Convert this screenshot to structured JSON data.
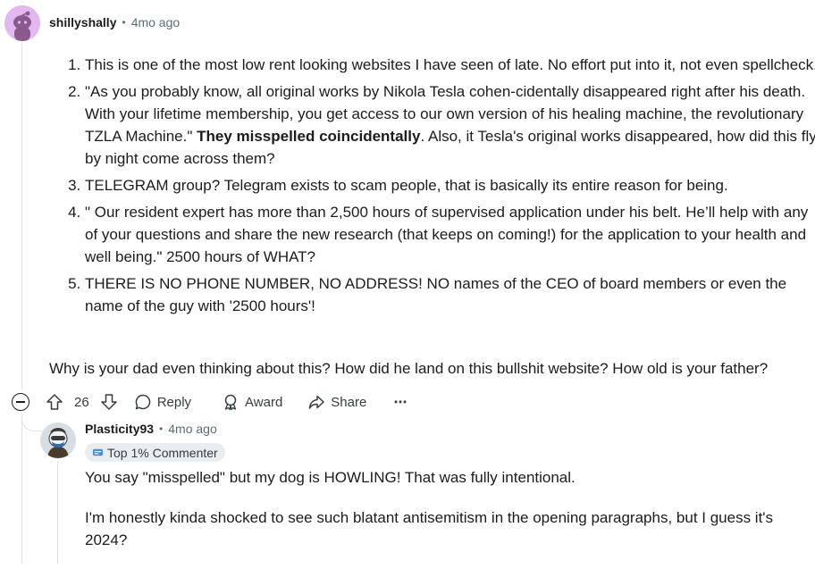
{
  "comment": {
    "author": "shillyshally",
    "time": "4mo ago",
    "list": [
      {
        "text": "This is one of the most low rent looking websites I have seen of late. No effort put into it, not even spellcheck."
      },
      {
        "before": "\"As you probably know, all original works by Nikola Tesla cohen-cidentally disappeared right after his death. With your lifetime membership, you get access to our own version of his healing machine, the revolutionary TZLA Machine.\" ",
        "bold": "They misspelled coincidentally",
        "after": ". Also, it Tesla's original works disappeared, how did this fly by night come across them?"
      },
      {
        "text": "TELEGRAM group? Telegram exists to scam people, that is basically its entire reason for being."
      },
      {
        "text": "\" Our resident expert has more than 2,500 hours of supervised application under his belt. He’ll help with any of your questions and share the new research (that keeps on coming!) for the application to your health and well being.\" 2500 hours of WHAT?"
      },
      {
        "text": "THERE IS NO PHONE NUMBER, NO ADDRESS! NO names of the CEO of board members or even the name of the guy with '2500 hours'!"
      }
    ],
    "closing": "Why is your dad even thinking about this? How did he land on this bullshit website? How old is your father?",
    "votes": "26",
    "reply_label": "Reply",
    "award_label": "Award",
    "share_label": "Share",
    "more_label": "⋯"
  },
  "reply": {
    "author": "Plasticity93",
    "time": "4mo ago",
    "flair": "Top 1% Commenter",
    "paragraphs": [
      "You say \"misspelled\" but my dog is HOWLING!  That was fully intentional.",
      "I'm honestly kinda shocked to see such blatant antisemitism in the opening paragraphs, but I guess it's 2024?"
    ]
  },
  "colors": {
    "meta": "#576f76",
    "thread": "#e0e2e4",
    "flair_bg": "#eaedef",
    "avatar1": "#e2b8f0"
  }
}
